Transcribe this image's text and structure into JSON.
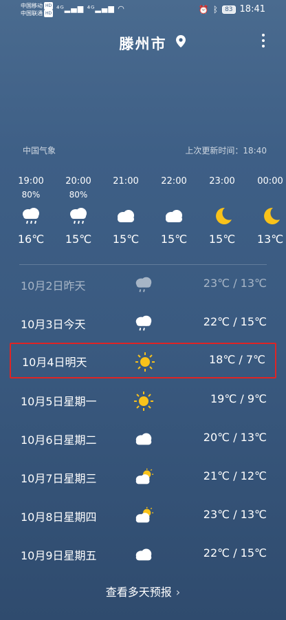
{
  "status": {
    "carrier1": "中国移动",
    "carrier2": "中国联通",
    "hd": "HD",
    "signal": "⁴ᴳ▂▄▆ ⁴ᴳ▂▄▆ ◠",
    "battery": "83",
    "time": "18:41"
  },
  "header": {
    "city": "滕州市"
  },
  "info": {
    "source": "中国气象",
    "updated": "上次更新时间：18:40"
  },
  "hourly": [
    {
      "time": "19:00",
      "precip": "80%",
      "icon": "rain-cloud-icon",
      "temp": "16℃"
    },
    {
      "time": "20:00",
      "precip": "80%",
      "icon": "rain-cloud-icon",
      "temp": "15℃"
    },
    {
      "time": "21:00",
      "precip": "",
      "icon": "cloud-icon",
      "temp": "15℃"
    },
    {
      "time": "22:00",
      "precip": "",
      "icon": "cloud-icon",
      "temp": "15℃"
    },
    {
      "time": "23:00",
      "precip": "",
      "icon": "moon-icon",
      "temp": "15℃"
    },
    {
      "time": "00:00",
      "precip": "",
      "icon": "moon-icon",
      "temp": "13℃"
    }
  ],
  "daily": [
    {
      "date": "10月2日昨天",
      "icon": "rain-cloud-icon",
      "range": "23℃ / 13℃"
    },
    {
      "date": "10月3日今天",
      "icon": "rain-cloud-icon",
      "range": "22℃ / 15℃"
    },
    {
      "date": "10月4日明天",
      "icon": "sun-icon",
      "range": "18℃ / 7℃"
    },
    {
      "date": "10月5日星期一",
      "icon": "sun-icon",
      "range": "19℃ / 9℃"
    },
    {
      "date": "10月6日星期二",
      "icon": "cloud-icon",
      "range": "20℃ / 13℃"
    },
    {
      "date": "10月7日星期三",
      "icon": "partly-cloudy-icon",
      "range": "21℃ / 12℃"
    },
    {
      "date": "10月8日星期四",
      "icon": "partly-cloudy-icon",
      "range": "23℃ / 13℃"
    },
    {
      "date": "10月9日星期五",
      "icon": "cloud-icon",
      "range": "22℃ / 15℃"
    }
  ],
  "more": {
    "label": "查看多天预报",
    "chevron": "›"
  },
  "colors": {
    "accent_sun": "#f9c21a",
    "highlight": "#e02424"
  }
}
